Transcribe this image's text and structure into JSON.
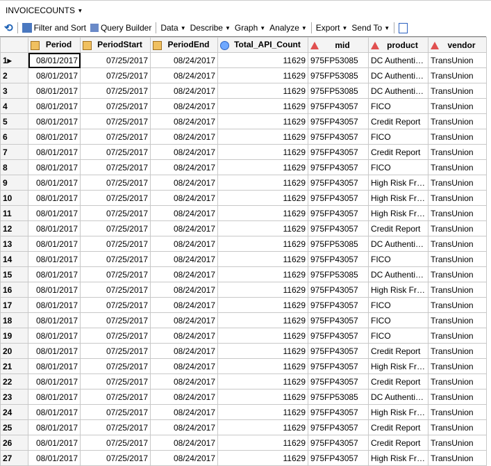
{
  "title": "INVOICECOUNTS",
  "toolbar": {
    "filter": "Filter and Sort",
    "query": "Query Builder",
    "data": "Data",
    "describe": "Describe",
    "graph": "Graph",
    "analyze": "Analyze",
    "export": "Export",
    "send": "Send To"
  },
  "columns": [
    {
      "name": "Period",
      "type": "date"
    },
    {
      "name": "PeriodStart",
      "type": "date"
    },
    {
      "name": "PeriodEnd",
      "type": "date"
    },
    {
      "name": "Total_API_Count",
      "type": "numeric"
    },
    {
      "name": "mid",
      "type": "char"
    },
    {
      "name": "product",
      "type": "char"
    },
    {
      "name": "vendor",
      "type": "char"
    }
  ],
  "rows": [
    [
      "08/01/2017",
      "07/25/2017",
      "08/24/2017",
      "11629",
      "975FP53085",
      "DC Authentica...",
      "TransUnion"
    ],
    [
      "08/01/2017",
      "07/25/2017",
      "08/24/2017",
      "11629",
      "975FP53085",
      "DC Authentica...",
      "TransUnion"
    ],
    [
      "08/01/2017",
      "07/25/2017",
      "08/24/2017",
      "11629",
      "975FP53085",
      "DC Authentica...",
      "TransUnion"
    ],
    [
      "08/01/2017",
      "07/25/2017",
      "08/24/2017",
      "11629",
      "975FP43057",
      "FICO",
      "TransUnion"
    ],
    [
      "08/01/2017",
      "07/25/2017",
      "08/24/2017",
      "11629",
      "975FP43057",
      "Credit Report",
      "TransUnion"
    ],
    [
      "08/01/2017",
      "07/25/2017",
      "08/24/2017",
      "11629",
      "975FP43057",
      "FICO",
      "TransUnion"
    ],
    [
      "08/01/2017",
      "07/25/2017",
      "08/24/2017",
      "11629",
      "975FP43057",
      "Credit Report",
      "TransUnion"
    ],
    [
      "08/01/2017",
      "07/25/2017",
      "08/24/2017",
      "11629",
      "975FP43057",
      "FICO",
      "TransUnion"
    ],
    [
      "08/01/2017",
      "07/25/2017",
      "08/24/2017",
      "11629",
      "975FP43057",
      "High Risk Fra...",
      "TransUnion"
    ],
    [
      "08/01/2017",
      "07/25/2017",
      "08/24/2017",
      "11629",
      "975FP43057",
      "High Risk Fra...",
      "TransUnion"
    ],
    [
      "08/01/2017",
      "07/25/2017",
      "08/24/2017",
      "11629",
      "975FP43057",
      "High Risk Fra...",
      "TransUnion"
    ],
    [
      "08/01/2017",
      "07/25/2017",
      "08/24/2017",
      "11629",
      "975FP43057",
      "Credit Report",
      "TransUnion"
    ],
    [
      "08/01/2017",
      "07/25/2017",
      "08/24/2017",
      "11629",
      "975FP53085",
      "DC Authentica...",
      "TransUnion"
    ],
    [
      "08/01/2017",
      "07/25/2017",
      "08/24/2017",
      "11629",
      "975FP43057",
      "FICO",
      "TransUnion"
    ],
    [
      "08/01/2017",
      "07/25/2017",
      "08/24/2017",
      "11629",
      "975FP53085",
      "DC Authentica...",
      "TransUnion"
    ],
    [
      "08/01/2017",
      "07/25/2017",
      "08/24/2017",
      "11629",
      "975FP43057",
      "High Risk Fra...",
      "TransUnion"
    ],
    [
      "08/01/2017",
      "07/25/2017",
      "08/24/2017",
      "11629",
      "975FP43057",
      "FICO",
      "TransUnion"
    ],
    [
      "08/01/2017",
      "07/25/2017",
      "08/24/2017",
      "11629",
      "975FP43057",
      "FICO",
      "TransUnion"
    ],
    [
      "08/01/2017",
      "07/25/2017",
      "08/24/2017",
      "11629",
      "975FP43057",
      "FICO",
      "TransUnion"
    ],
    [
      "08/01/2017",
      "07/25/2017",
      "08/24/2017",
      "11629",
      "975FP43057",
      "Credit Report",
      "TransUnion"
    ],
    [
      "08/01/2017",
      "07/25/2017",
      "08/24/2017",
      "11629",
      "975FP43057",
      "High Risk Fra...",
      "TransUnion"
    ],
    [
      "08/01/2017",
      "07/25/2017",
      "08/24/2017",
      "11629",
      "975FP43057",
      "Credit Report",
      "TransUnion"
    ],
    [
      "08/01/2017",
      "07/25/2017",
      "08/24/2017",
      "11629",
      "975FP53085",
      "DC Authentica...",
      "TransUnion"
    ],
    [
      "08/01/2017",
      "07/25/2017",
      "08/24/2017",
      "11629",
      "975FP43057",
      "High Risk Fra...",
      "TransUnion"
    ],
    [
      "08/01/2017",
      "07/25/2017",
      "08/24/2017",
      "11629",
      "975FP43057",
      "Credit Report",
      "TransUnion"
    ],
    [
      "08/01/2017",
      "07/25/2017",
      "08/24/2017",
      "11629",
      "975FP43057",
      "Credit Report",
      "TransUnion"
    ],
    [
      "08/01/2017",
      "07/25/2017",
      "08/24/2017",
      "11629",
      "975FP43057",
      "High Risk Fra...",
      "TransUnion"
    ]
  ]
}
